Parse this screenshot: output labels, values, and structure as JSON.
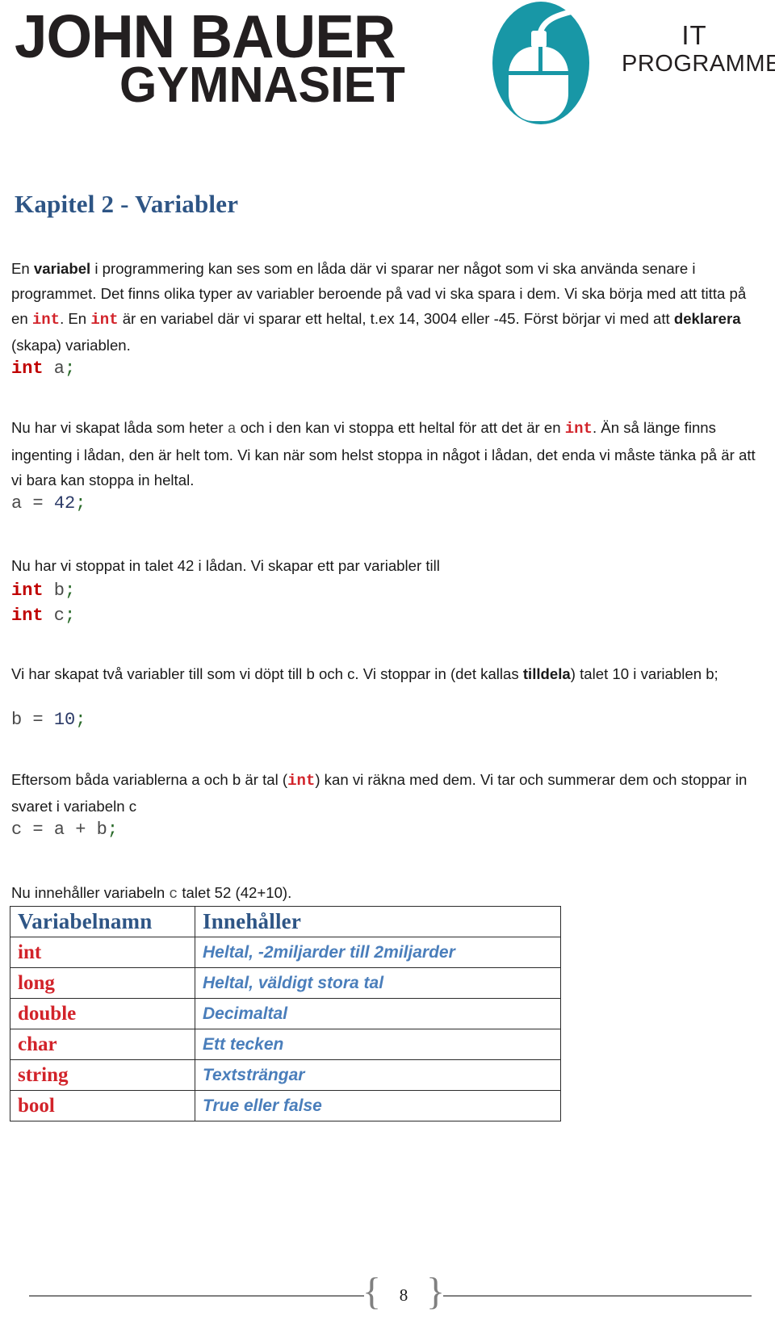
{
  "header": {
    "logo": {
      "line1": "JOHN BAUER",
      "line2": "GYMNASIET",
      "mark_icon": "computer-mouse-icon",
      "mark_color": "#1897a6",
      "sub_line1": "IT",
      "sub_line2": "PROGRAMMET"
    }
  },
  "chapter": {
    "title": "Kapitel 2 - Variabler"
  },
  "content": {
    "p1_a": "En ",
    "p1_b": "variabel",
    "p1_c": " i programmering kan ses som en låda där vi sparar ner något som vi ska använda senare i programmet. Det finns olika typer av variabler beroende på vad vi ska spara i dem. Vi ska börja med att titta på en ",
    "p1_kw1": "int",
    "p1_d": ". En ",
    "p1_kw2": "int",
    "p1_e": "  är en variabel där vi sparar ett heltal, t.ex 14, 3004 eller -45. Först börjar vi med att ",
    "p1_f": "deklarera",
    "p1_g": " (skapa) variablen.",
    "code1_kw": "int",
    "code1_id": " a",
    "code1_semi": ";",
    "p2_a": "Nu har vi skapat låda som heter ",
    "p2_id": "a",
    "p2_b": " och i den kan vi stoppa ett heltal för att det är en  ",
    "p2_kw": "int",
    "p2_c": ". Än så länge finns ingenting i lådan, den är helt tom. Vi kan när som helst stoppa in något i lådan, det enda vi måste tänka på är att vi bara kan stoppa in heltal.",
    "code2_id": "a ",
    "code2_op": "= ",
    "code2_num": "42",
    "code2_semi": ";",
    "p3": "Nu har vi stoppat in talet 42 i lådan. Vi skapar ett par variabler till",
    "code3_kw": "int",
    "code3_id": " b",
    "code3_semi": ";",
    "code4_kw": "int",
    "code4_id": " c",
    "code4_semi": ";",
    "p4_a": " Vi har skapat två variabler till som vi döpt till b och c. Vi stoppar in (det kallas ",
    "p4_b": "tilldela",
    "p4_c": ") talet 10 i variablen b;",
    "code5_id": "b ",
    "code5_op": "= ",
    "code5_num": "10",
    "code5_semi": ";",
    "p5_a": "Eftersom båda variablerna a och b är tal (",
    "p5_kw": "int",
    "p5_b": ") kan vi räkna med dem. Vi tar och summerar dem och stoppar in svaret i variabeln c",
    "code6_id": "c ",
    "code6_op": "= ",
    "code6_id2": "a ",
    "code6_plus": "+ ",
    "code6_id3": "b",
    "code6_semi": ";",
    "p6_a": "Nu innehåller variabeln ",
    "p6_id": "c",
    "p6_b": " talet 52 (42+10)."
  },
  "table": {
    "headers": [
      "Variabelnamn",
      "Innehåller"
    ],
    "rows": [
      {
        "name": "int",
        "desc": "Heltal, -2miljarder till 2miljarder"
      },
      {
        "name": "long",
        "desc": "Heltal, väldigt stora tal"
      },
      {
        "name": "double",
        "desc": "Decimaltal"
      },
      {
        "name": "char",
        "desc": "Ett tecken"
      },
      {
        "name": "string",
        "desc": "Textsträngar"
      },
      {
        "name": "bool",
        "desc": "True eller false"
      }
    ]
  },
  "footer": {
    "brace_left": "{",
    "page_number": "8",
    "brace_right": "}"
  },
  "colors": {
    "brand_teal": "#1897a6",
    "heading_blue": "#2e5585",
    "keyword_red": "#d2232a",
    "table_type_red": "#d2232a",
    "table_desc_blue": "#4a7ebb",
    "code_gray": "#4a4a4a",
    "footer_gray": "#808080"
  }
}
